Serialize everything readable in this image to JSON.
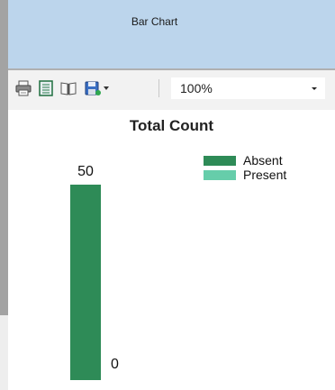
{
  "header": {
    "title": "Bar Chart"
  },
  "toolbar": {
    "buttons": [
      {
        "icon": "printer-icon"
      },
      {
        "icon": "page-setup-icon"
      },
      {
        "icon": "book-icon"
      },
      {
        "icon": "save-icon"
      }
    ],
    "zoom": "100%"
  },
  "chart_data": {
    "type": "bar",
    "title": "Total Count",
    "categories": [
      ""
    ],
    "series": [
      {
        "name": "Absent",
        "color": "#2e8b57",
        "values": [
          50
        ]
      },
      {
        "name": "Present",
        "color": "#66cdaa",
        "values": [
          0
        ]
      }
    ],
    "yticks": [
      50,
      0
    ],
    "ylim": [
      0,
      50
    ]
  }
}
